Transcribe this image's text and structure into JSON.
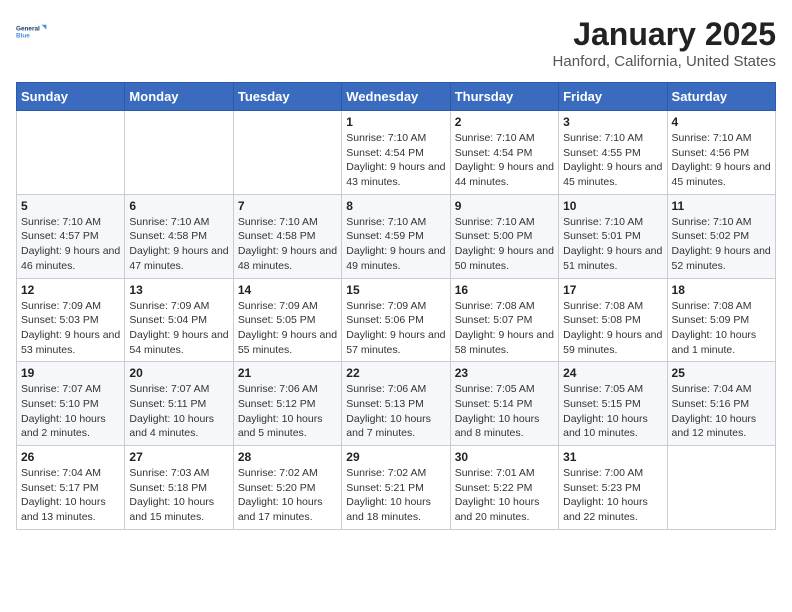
{
  "header": {
    "logo_line1": "General",
    "logo_line2": "Blue",
    "title": "January 2025",
    "subtitle": "Hanford, California, United States"
  },
  "calendar": {
    "days_of_week": [
      "Sunday",
      "Monday",
      "Tuesday",
      "Wednesday",
      "Thursday",
      "Friday",
      "Saturday"
    ],
    "weeks": [
      [
        {
          "day": null,
          "detail": null
        },
        {
          "day": null,
          "detail": null
        },
        {
          "day": null,
          "detail": null
        },
        {
          "day": "1",
          "detail": "Sunrise: 7:10 AM\nSunset: 4:54 PM\nDaylight: 9 hours and 43 minutes."
        },
        {
          "day": "2",
          "detail": "Sunrise: 7:10 AM\nSunset: 4:54 PM\nDaylight: 9 hours and 44 minutes."
        },
        {
          "day": "3",
          "detail": "Sunrise: 7:10 AM\nSunset: 4:55 PM\nDaylight: 9 hours and 45 minutes."
        },
        {
          "day": "4",
          "detail": "Sunrise: 7:10 AM\nSunset: 4:56 PM\nDaylight: 9 hours and 45 minutes."
        }
      ],
      [
        {
          "day": "5",
          "detail": "Sunrise: 7:10 AM\nSunset: 4:57 PM\nDaylight: 9 hours and 46 minutes."
        },
        {
          "day": "6",
          "detail": "Sunrise: 7:10 AM\nSunset: 4:58 PM\nDaylight: 9 hours and 47 minutes."
        },
        {
          "day": "7",
          "detail": "Sunrise: 7:10 AM\nSunset: 4:58 PM\nDaylight: 9 hours and 48 minutes."
        },
        {
          "day": "8",
          "detail": "Sunrise: 7:10 AM\nSunset: 4:59 PM\nDaylight: 9 hours and 49 minutes."
        },
        {
          "day": "9",
          "detail": "Sunrise: 7:10 AM\nSunset: 5:00 PM\nDaylight: 9 hours and 50 minutes."
        },
        {
          "day": "10",
          "detail": "Sunrise: 7:10 AM\nSunset: 5:01 PM\nDaylight: 9 hours and 51 minutes."
        },
        {
          "day": "11",
          "detail": "Sunrise: 7:10 AM\nSunset: 5:02 PM\nDaylight: 9 hours and 52 minutes."
        }
      ],
      [
        {
          "day": "12",
          "detail": "Sunrise: 7:09 AM\nSunset: 5:03 PM\nDaylight: 9 hours and 53 minutes."
        },
        {
          "day": "13",
          "detail": "Sunrise: 7:09 AM\nSunset: 5:04 PM\nDaylight: 9 hours and 54 minutes."
        },
        {
          "day": "14",
          "detail": "Sunrise: 7:09 AM\nSunset: 5:05 PM\nDaylight: 9 hours and 55 minutes."
        },
        {
          "day": "15",
          "detail": "Sunrise: 7:09 AM\nSunset: 5:06 PM\nDaylight: 9 hours and 57 minutes."
        },
        {
          "day": "16",
          "detail": "Sunrise: 7:08 AM\nSunset: 5:07 PM\nDaylight: 9 hours and 58 minutes."
        },
        {
          "day": "17",
          "detail": "Sunrise: 7:08 AM\nSunset: 5:08 PM\nDaylight: 9 hours and 59 minutes."
        },
        {
          "day": "18",
          "detail": "Sunrise: 7:08 AM\nSunset: 5:09 PM\nDaylight: 10 hours and 1 minute."
        }
      ],
      [
        {
          "day": "19",
          "detail": "Sunrise: 7:07 AM\nSunset: 5:10 PM\nDaylight: 10 hours and 2 minutes."
        },
        {
          "day": "20",
          "detail": "Sunrise: 7:07 AM\nSunset: 5:11 PM\nDaylight: 10 hours and 4 minutes."
        },
        {
          "day": "21",
          "detail": "Sunrise: 7:06 AM\nSunset: 5:12 PM\nDaylight: 10 hours and 5 minutes."
        },
        {
          "day": "22",
          "detail": "Sunrise: 7:06 AM\nSunset: 5:13 PM\nDaylight: 10 hours and 7 minutes."
        },
        {
          "day": "23",
          "detail": "Sunrise: 7:05 AM\nSunset: 5:14 PM\nDaylight: 10 hours and 8 minutes."
        },
        {
          "day": "24",
          "detail": "Sunrise: 7:05 AM\nSunset: 5:15 PM\nDaylight: 10 hours and 10 minutes."
        },
        {
          "day": "25",
          "detail": "Sunrise: 7:04 AM\nSunset: 5:16 PM\nDaylight: 10 hours and 12 minutes."
        }
      ],
      [
        {
          "day": "26",
          "detail": "Sunrise: 7:04 AM\nSunset: 5:17 PM\nDaylight: 10 hours and 13 minutes."
        },
        {
          "day": "27",
          "detail": "Sunrise: 7:03 AM\nSunset: 5:18 PM\nDaylight: 10 hours and 15 minutes."
        },
        {
          "day": "28",
          "detail": "Sunrise: 7:02 AM\nSunset: 5:20 PM\nDaylight: 10 hours and 17 minutes."
        },
        {
          "day": "29",
          "detail": "Sunrise: 7:02 AM\nSunset: 5:21 PM\nDaylight: 10 hours and 18 minutes."
        },
        {
          "day": "30",
          "detail": "Sunrise: 7:01 AM\nSunset: 5:22 PM\nDaylight: 10 hours and 20 minutes."
        },
        {
          "day": "31",
          "detail": "Sunrise: 7:00 AM\nSunset: 5:23 PM\nDaylight: 10 hours and 22 minutes."
        },
        {
          "day": null,
          "detail": null
        }
      ]
    ]
  }
}
